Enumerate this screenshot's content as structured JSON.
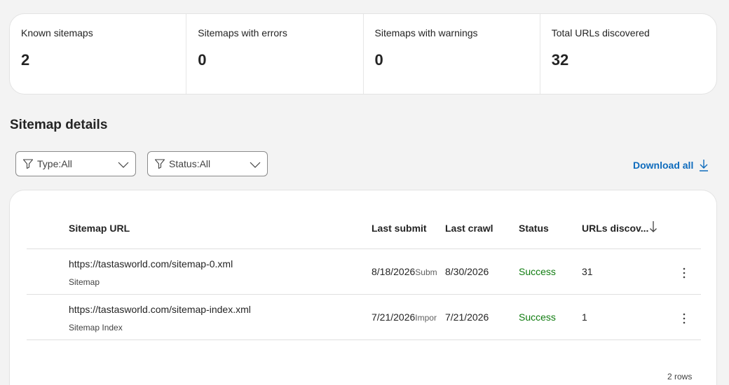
{
  "summary": [
    {
      "label": "Known sitemaps",
      "value": "2"
    },
    {
      "label": "Sitemaps with errors",
      "value": "0"
    },
    {
      "label": "Sitemaps with warnings",
      "value": "0"
    },
    {
      "label": "Total URLs discovered",
      "value": "32"
    }
  ],
  "section_title": "Sitemap details",
  "filters": {
    "type_label": "Type:All",
    "status_label": "Status:All"
  },
  "download_label": "Download all",
  "table": {
    "columns": [
      "Sitemap URL",
      "Last submit",
      "Last crawl",
      "Status",
      "URLs discov..."
    ],
    "rows": [
      {
        "url": "https://tastasworld.com/sitemap-0.xml",
        "type": "Sitemap",
        "last_submit": "8/18/2026",
        "submit_note": "Subm",
        "last_crawl": "8/30/2026",
        "status": "Success",
        "urls": "31"
      },
      {
        "url": "https://tastasworld.com/sitemap-index.xml",
        "type": "Sitemap Index",
        "last_submit": "7/21/2026",
        "submit_note": "Impor",
        "last_crawl": "7/21/2026",
        "status": "Success",
        "urls": "1"
      }
    ],
    "row_count": "2 rows"
  },
  "colors": {
    "accent": "#0f6cbd",
    "success": "#107c10"
  },
  "icons": [
    "filter-icon",
    "chevron-down-icon",
    "download-icon",
    "sort-descending-icon",
    "more-vertical-icon"
  ]
}
